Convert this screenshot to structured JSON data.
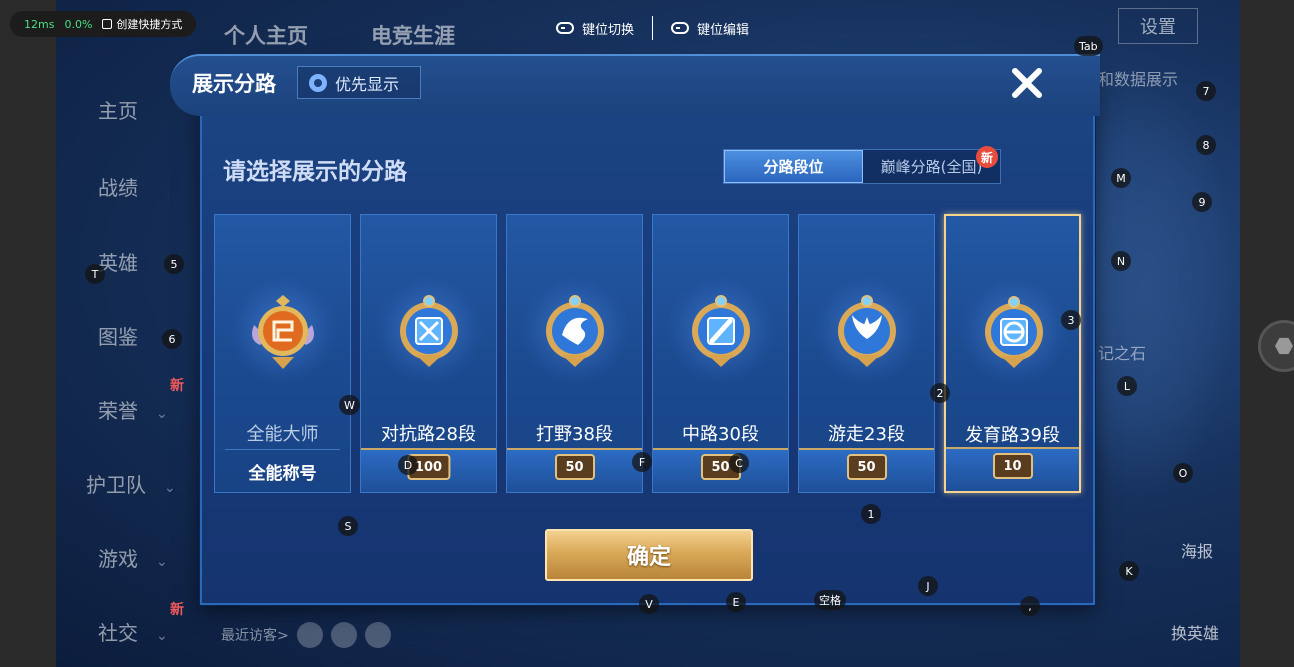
{
  "overlay": {
    "latency": "12ms",
    "cpu": "0.0%",
    "shortcut_label": "创建快捷方式",
    "key_switch": "键位切换",
    "key_edit": "键位编辑"
  },
  "background": {
    "tabs": [
      "个人主页",
      "电竞生涯"
    ],
    "settings": "设置",
    "side_menu": [
      "主页",
      "战绩",
      "英雄",
      "图鉴",
      "荣誉",
      "护卫队",
      "游戏",
      "社交"
    ],
    "visitor_label": "最近访客>",
    "data_display": "和数据展示",
    "stone_text": "记之石",
    "poster": "海报",
    "change_hero": "换英雄",
    "new_badge": "新"
  },
  "dialog": {
    "title": "展示分路",
    "priority_label": "优先显示",
    "subtitle": "请选择展示的分路",
    "segments": [
      {
        "label": "分路段位",
        "active": true
      },
      {
        "label": "巅峰分路(全国)",
        "active": false,
        "badge": "新"
      }
    ],
    "cards": [
      {
        "name": "全能大师",
        "action": "全能称号",
        "first": true,
        "emblem": "orange-allround-emblem",
        "selected": false
      },
      {
        "name": "对抗路28段",
        "rank": "100",
        "emblem": "crossed-swords-emblem",
        "selected": false
      },
      {
        "name": "打野38段",
        "rank": "50",
        "emblem": "dragon-emblem",
        "selected": false
      },
      {
        "name": "中路30段",
        "rank": "50",
        "emblem": "staff-emblem",
        "selected": false
      },
      {
        "name": "游走23段",
        "rank": "50",
        "emblem": "wings-emblem",
        "selected": false
      },
      {
        "name": "发育路39段",
        "rank": "10",
        "emblem": "bow-emblem",
        "selected": true
      }
    ],
    "confirm": "确定"
  },
  "keys": [
    "Tab",
    "7",
    "8",
    "M",
    "9",
    "T",
    "5",
    "N",
    "3",
    "6",
    "L",
    "2",
    "W",
    "D",
    "F",
    "C",
    "O",
    "S",
    "1",
    "J",
    "K",
    "V",
    "E",
    "空格",
    ","
  ],
  "colors": {
    "dialog_bg": "#1c4583",
    "accent_gold": "#d9a957",
    "selected_border": "#f6d28f",
    "active_segment": "#4d8fe0",
    "new_badge": "#e84c3d"
  }
}
